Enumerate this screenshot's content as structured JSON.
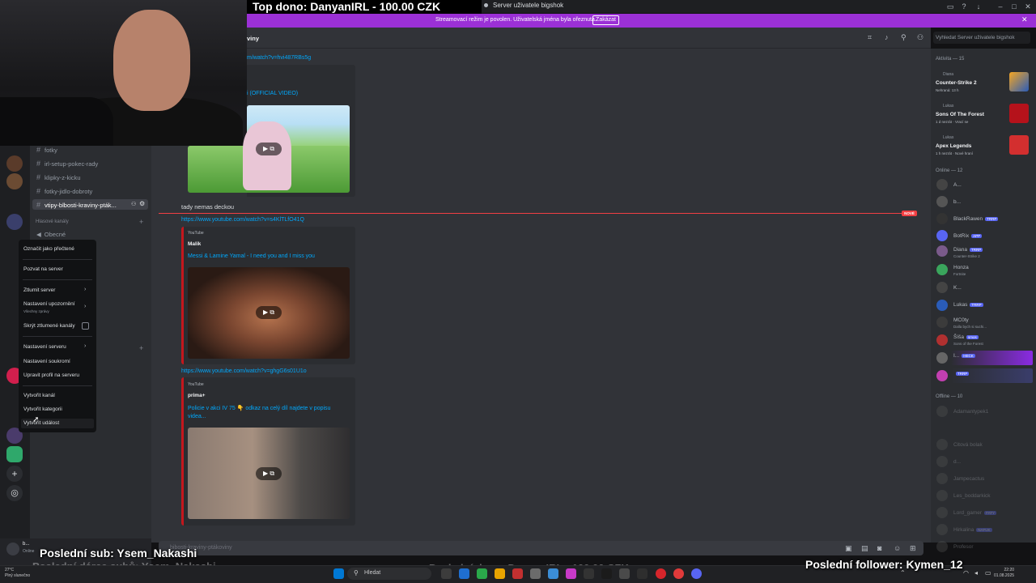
{
  "overlay": {
    "top_donor": "Top dono: DanyanIRL - 100.00 CZK",
    "last_sub": "Poslední sub: Ysem_Nakashi",
    "last_sub_donor_faded": "Poslední dárce subů: Ysem_Nakashi",
    "last_donor_faded": "Poslední dono: DanyanIRL - 100.00 CZK",
    "last_follower": "Poslední follower: Kymen_12"
  },
  "window": {
    "title": "Server uživatele bigshok"
  },
  "stream_banner": {
    "message": "Streamovací režim je povolen. Uživatelská jména byla ořeznuta.",
    "button": "Zakázat"
  },
  "chat": {
    "channel_title": "viny",
    "search_placeholder": "Vyhledat Server uživatele bigshok",
    "input_placeholder": "bibosti-kraviny-ptákoviny",
    "new_badge": "NOVÉ",
    "messages": [
      {
        "link": "m/watch?v=hvi487RBs5g",
        "embed_title": "i (OFFICIAL VIDEO)"
      },
      {
        "text": "tady nemas deckou"
      },
      {
        "link": "https://www.youtube.com/watch?v=s4KlTLfO41Q",
        "provider": "YouTube",
        "author": "Malik",
        "embed_title": "Messi & Lamine Yamal - I need you and I miss you"
      },
      {
        "link": "https://www.youtube.com/watch?v=ghgG6s01U1o",
        "provider": "YouTube",
        "author": "prima+",
        "embed_title_1": "Policie v akci IV 75 👇 odkaz na celý díl najdete v popisu",
        "embed_title_2": "videa..."
      }
    ]
  },
  "channels": {
    "items": [
      {
        "label": "fotky"
      },
      {
        "label": "irl-setup-pokec-rady"
      },
      {
        "label": "klipky-z-kicku"
      },
      {
        "label": "fotky-jidlo-dobroty"
      },
      {
        "label": "vtipy-blbosti-kraviny-pták..."
      }
    ],
    "voice_header": "Hlasové kanály",
    "voice_item": "Obecné"
  },
  "context_menu": {
    "items": [
      {
        "label": "Označit jako přečtené"
      },
      {
        "label": "Pozvat na server"
      },
      {
        "label": "Ztlumit server"
      },
      {
        "label": "Nastavení upozornění",
        "sub": "Všechny zprávy"
      },
      {
        "label": "Skrýt ztlumené kanály"
      },
      {
        "label": "Nastavení serveru"
      },
      {
        "label": "Nastavení soukromí"
      },
      {
        "label": "Upravit profil na serveru"
      },
      {
        "label": "Vytvořit kanál"
      },
      {
        "label": "Vytvořit kategorii"
      },
      {
        "label": "Vytvořit událost"
      }
    ]
  },
  "members": {
    "activity_header": "Aktivita — 15",
    "activities": [
      {
        "user": "Diana",
        "game": "Counter-Strike 2",
        "detail": "Nehraná: 13 h"
      },
      {
        "user": "Lukas",
        "game": "Sons Of The Forest",
        "detail": "1 d nezrát · Vrací se"
      },
      {
        "user": "Lukas",
        "game": "Apex Legends",
        "detail": "1 h nezrát · Nové hraní"
      }
    ],
    "online_header": "Online — 12",
    "online": [
      {
        "name": "A...",
        "status": ""
      },
      {
        "name": "b...",
        "status": ""
      },
      {
        "name": "BlackRawen",
        "tag": "TRRP",
        "status": ""
      },
      {
        "name": "BotRix",
        "tag": "APP",
        "status": ""
      },
      {
        "name": "Diana",
        "tag": "TRRP",
        "status": "Counter-Strike 2"
      },
      {
        "name": "Honza",
        "status": "Fortnite"
      },
      {
        "name": "K...",
        "status": ""
      },
      {
        "name": "Lukas",
        "tag": "TRRP",
        "status": ""
      },
      {
        "name": "MC0ty",
        "status": "Dalla bych si suchi..."
      },
      {
        "name": "Šíša",
        "tag": "smos",
        "status": "Sons of the Forest"
      },
      {
        "name": "I...",
        "tag": "HECK",
        "status": ""
      },
      {
        "name": "",
        "tag": "TRRP",
        "status": ""
      }
    ],
    "offline_header": "Offline — 10",
    "offline": [
      {
        "name": "Adamantypek1"
      },
      {
        "name": "Citová bolak"
      },
      {
        "name": "d..."
      },
      {
        "name": "Jampecactus"
      },
      {
        "name": "Les_boddarkick"
      },
      {
        "name": "Lord_gamer",
        "tag": "FATY"
      },
      {
        "name": "Hirkalina",
        "tag": "NAFUK"
      },
      {
        "name": "Profesor"
      }
    ]
  },
  "user_panel": {
    "name": "b...",
    "status": "Online"
  },
  "taskbar": {
    "weather_temp": "27°C",
    "weather_desc": "Plný slunečno",
    "search": "Hledat",
    "time": "22:20",
    "date": "01.08.2025"
  },
  "colors": {
    "banner": "#9b30d6",
    "accent": "#5865f2",
    "link": "#00a8fc",
    "embed_border": "#c4171d",
    "new_marker": "#f23f43"
  }
}
